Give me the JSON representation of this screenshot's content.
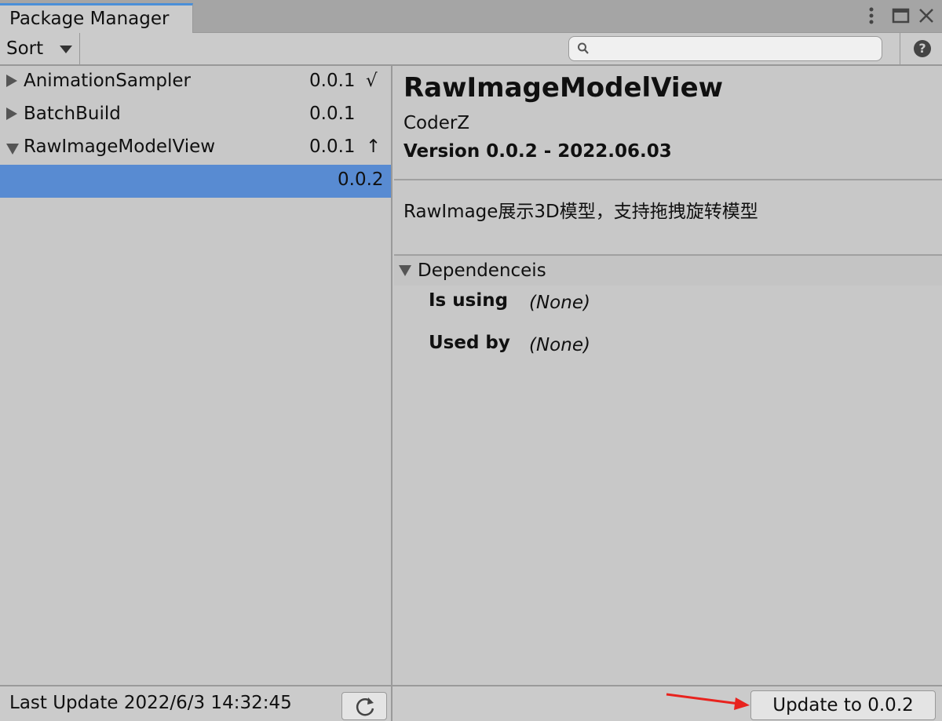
{
  "window": {
    "tab_title": "Package Manager",
    "controls": {
      "menu_icon": "kebab-icon",
      "maximize_icon": "maximize-icon",
      "close_icon": "close-icon"
    }
  },
  "toolbar": {
    "sort_label": "Sort",
    "search": {
      "value": "",
      "placeholder": ""
    },
    "help_label": "?"
  },
  "packages": [
    {
      "name": "AnimationSampler",
      "version": "0.0.1",
      "status": "√",
      "expanded": false
    },
    {
      "name": "BatchBuild",
      "version": "0.0.1",
      "status": "",
      "expanded": false
    },
    {
      "name": "RawImageModelView",
      "version": "0.0.1",
      "status": "↑",
      "expanded": true,
      "sub_versions": [
        {
          "version": "0.0.2",
          "selected": true
        }
      ]
    }
  ],
  "details": {
    "title": "RawImageModelView",
    "author": "CoderZ",
    "version_line": "Version 0.0.2 - 2022.06.03",
    "description": "RawImage展示3D模型，支持拖拽旋转模型",
    "dependencies": {
      "header": "Dependenceis",
      "is_using_label": "Is using",
      "is_using_value": "(None)",
      "used_by_label": "Used by",
      "used_by_value": "(None)"
    }
  },
  "footer": {
    "last_update": "Last Update 2022/6/3 14:32:45",
    "update_button": "Update to 0.0.2"
  },
  "colors": {
    "selection": "#588bd2",
    "tab_accent": "#4a8fd8",
    "arrow": "#e8231e"
  }
}
